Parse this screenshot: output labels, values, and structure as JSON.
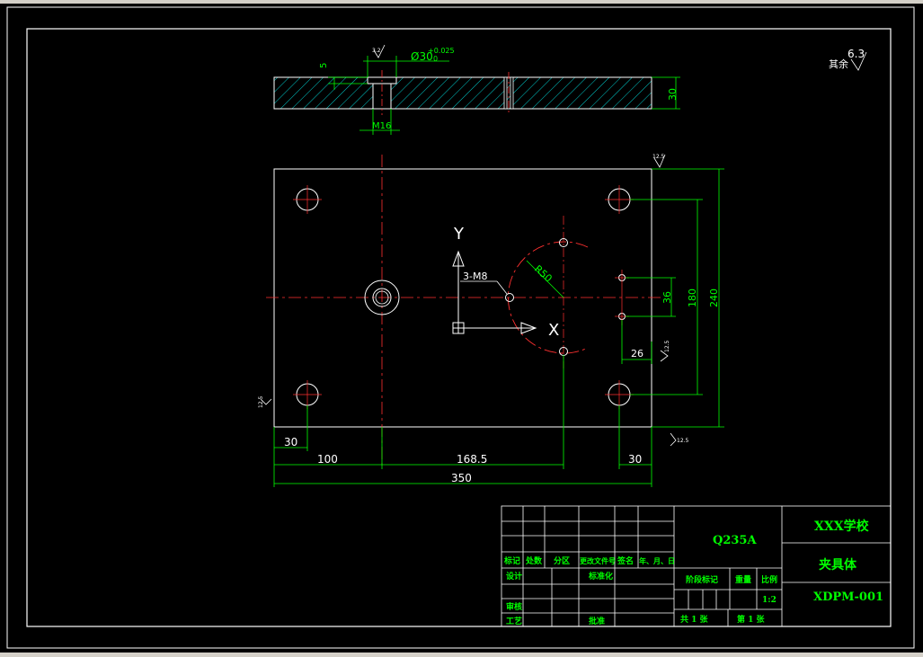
{
  "dims": {
    "m16": "M16",
    "phi30": "Ø30",
    "tol": "+0.025",
    "tol2": "0",
    "depth5": "5",
    "thick30": "30",
    "r50": "R50",
    "m8": "3-M8",
    "axis_x": "X",
    "axis_y": "Y",
    "d36": "36",
    "d180": "180",
    "d240": "240",
    "d26": "26",
    "d30a": "30",
    "d100": "100",
    "d168": "168.5",
    "d30b": "30",
    "d350": "350"
  },
  "roughness": {
    "main_value": "6.3",
    "main_note": "其余",
    "small": "12.5",
    "small_b": "12.5",
    "small_c": "12.5",
    "small_d": "12.5",
    "small_e": "12.5",
    "small_f": "3.2"
  },
  "title_block": {
    "material": "Q235A",
    "school": "XXX学校",
    "part_name": "夹具体",
    "drawing_no": "XDPM-001",
    "h_mark": "标记",
    "h_count": "处数",
    "h_zone": "分区",
    "h_doc": "更改文件号",
    "h_sign": "签名",
    "h_date": "年、月、日",
    "h_design": "设计",
    "h_std": "标准化",
    "h_stage": "阶段标记",
    "h_weight": "重量",
    "h_scale": "比例",
    "scale": "1:2",
    "h_check": "审核",
    "h_process": "工艺",
    "h_approve": "批准",
    "sheets_total": "共 1 张",
    "sheet_no": "第 1 张"
  }
}
